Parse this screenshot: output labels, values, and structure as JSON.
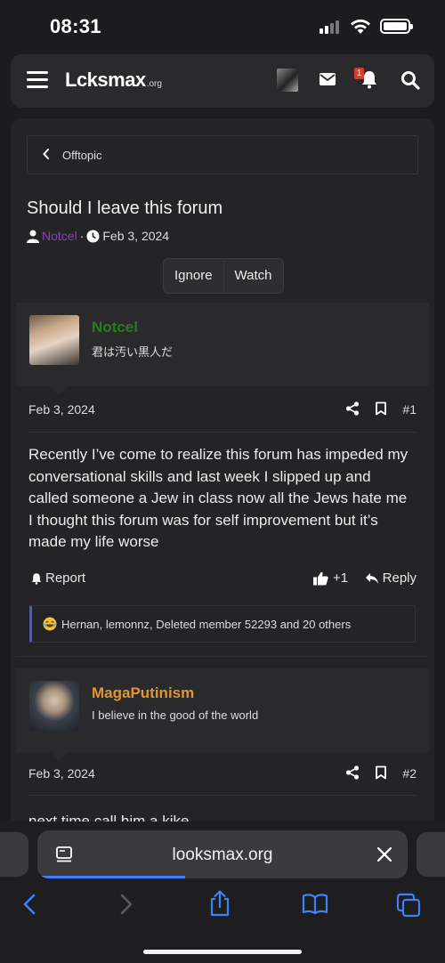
{
  "status_bar": {
    "time": "08:31"
  },
  "header": {
    "logo_main": "Lcksmax",
    "logo_suffix": ".org",
    "alert_count": "1"
  },
  "breadcrumb": {
    "label": "Offtopic"
  },
  "thread": {
    "title": "Should I leave this forum",
    "author": "Notcel",
    "separator": "·",
    "date": "Feb 3, 2024",
    "ignore_label": "Ignore",
    "watch_label": "Watch"
  },
  "posts": [
    {
      "username": "Notcel",
      "username_color": "#2c7a1e",
      "user_title": "君は汚い黒人だ",
      "date": "Feb 3, 2024",
      "number": "#1",
      "body": "Recently I’ve come to realize this forum has impeded my conversational skills and last week I slipped up and called someone a Jew in class now all the Jews hate me I thought this forum was for self improvement but it’s made my life worse",
      "report_label": "Report",
      "like_label": "+1",
      "reply_label": "Reply",
      "reactions": "Hernan, lemonnz, Deleted member 52293 and 20 others"
    },
    {
      "username": "MagaPutinism",
      "username_color": "#e0962e",
      "user_title": "I believe in the good of the world",
      "date": "Feb 3, 2024",
      "number": "#2",
      "body_peek": "next time call him a kike"
    }
  ],
  "browser": {
    "url": "looksmax.org",
    "accent": "#3c82f6"
  },
  "icons": [
    "hamburger-icon",
    "mail-icon",
    "bell-icon",
    "search-icon",
    "user-icon",
    "clock-icon",
    "share-icon",
    "bookmark-icon",
    "bell-report-icon",
    "thumbs-up-icon",
    "reply-icon",
    "laugh-emoji-icon",
    "tabs-icon",
    "close-icon",
    "back-icon",
    "forward-icon",
    "share-sheet-icon",
    "bookmarks-icon",
    "tab-overview-icon"
  ]
}
